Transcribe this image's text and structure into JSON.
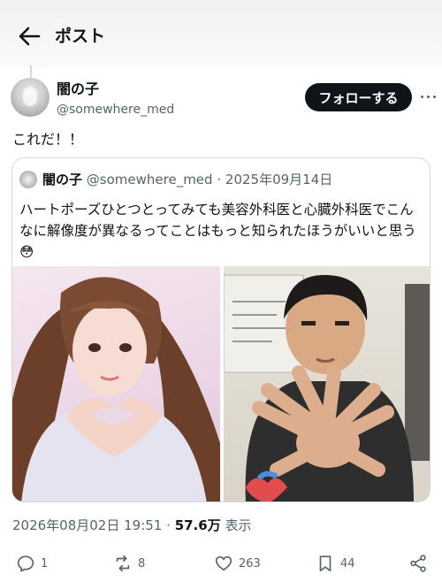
{
  "header": {
    "title": "ポスト",
    "back_icon": "arrow-left-icon"
  },
  "post": {
    "author_name": "闇の子",
    "author_handle": "@somewhere_med",
    "follow_label": "フォローする",
    "text": "これだ！！",
    "timestamp": "2026年08月02日 19:51",
    "views_count": "57.6万",
    "views_label": "表示"
  },
  "quote": {
    "author_name": "闇の子",
    "author_handle": "@somewhere_med",
    "date": "2025年09月14日",
    "text": "ハートポーズひとつとってみても美容外科医と心臓外科医でこんなに解像度が異なるってことはもっと知られたほうがいいと思う😳"
  },
  "actions": {
    "replies": "1",
    "reposts": "8",
    "likes": "263",
    "bookmarks": "44"
  },
  "colors": {
    "text": "#0f1419",
    "muted": "#536471",
    "border": "#cfd9de"
  }
}
